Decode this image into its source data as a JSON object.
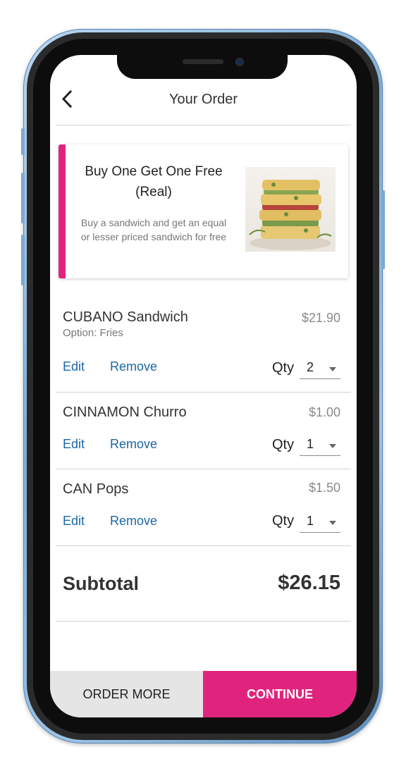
{
  "header": {
    "title": "Your Order",
    "back_icon": "chevron-left-icon"
  },
  "promo": {
    "title": "Buy One Get One Free (Real)",
    "description": "Buy a sandwich and get an equal or lesser priced sandwich for free",
    "accent_color": "#e0247e"
  },
  "items": [
    {
      "name": "CUBANO Sandwich",
      "option": "Option: Fries",
      "price": "$21.90",
      "qty_label": "Qty",
      "qty": "2",
      "edit_label": "Edit",
      "remove_label": "Remove"
    },
    {
      "name": "CINNAMON Churro",
      "option": "",
      "price": "$1.00",
      "qty_label": "Qty",
      "qty": "1",
      "edit_label": "Edit",
      "remove_label": "Remove"
    },
    {
      "name": "CAN Pops",
      "option": "",
      "price": "$1.50",
      "qty_label": "Qty",
      "qty": "1",
      "edit_label": "Edit",
      "remove_label": "Remove"
    }
  ],
  "summary": {
    "subtotal_label": "Subtotal",
    "subtotal_value": "$26.15"
  },
  "footer": {
    "order_more_label": "ORDER MORE",
    "continue_label": "CONTINUE"
  },
  "colors": {
    "link": "#1a66a8",
    "accent": "#e0247e",
    "secondary_button": "#e5e5e5"
  }
}
